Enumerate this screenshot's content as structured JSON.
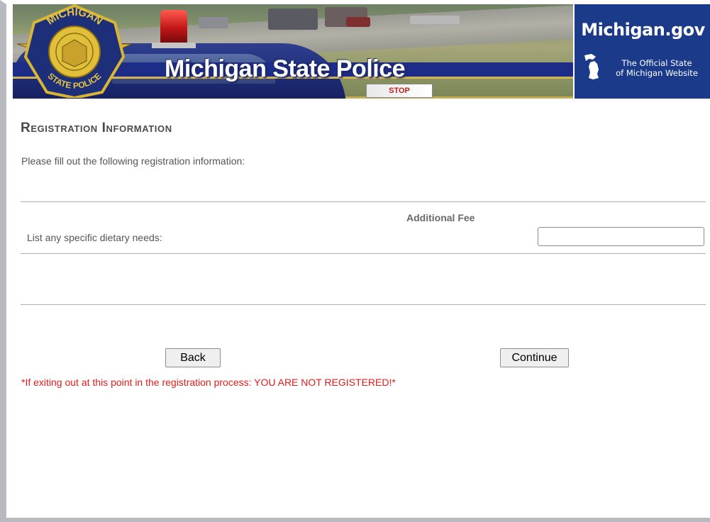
{
  "header": {
    "site_title": "Michigan State Police",
    "badge_text_top": "MICHIGAN",
    "badge_text_bottom": "STATE POLICE",
    "stop_sign_text": "STOP",
    "portal": {
      "logo": "Michigan.gov",
      "tagline_line1": "The Official State",
      "tagline_line2": "of Michigan Website"
    }
  },
  "form": {
    "heading": "Registration Information",
    "instructions": "Please fill out the following registration information:",
    "fee_column_header": "Additional Fee",
    "fields": [
      {
        "label": "List any specific dietary needs:",
        "value": ""
      }
    ]
  },
  "actions": {
    "back_label": "Back",
    "continue_label": "Continue"
  },
  "warning": "*If exiting out at this point in the registration process: YOU ARE NOT REGISTERED!*",
  "colors": {
    "banner_blue": "#1b3b8a",
    "warning_red": "#e31b1b",
    "heading_gray": "#4a4a4a"
  }
}
